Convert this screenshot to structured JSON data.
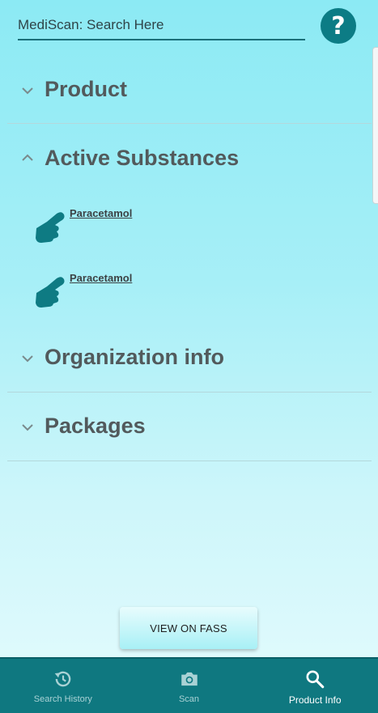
{
  "search": {
    "placeholder": "MediScan: Search Here"
  },
  "help": {
    "label": "?"
  },
  "sections": [
    {
      "title": "Product",
      "expanded": false
    },
    {
      "title": "Active Substances",
      "expanded": true,
      "items": [
        {
          "label": "Paracetamol"
        },
        {
          "label": "Paracetamol"
        }
      ]
    },
    {
      "title": "Organization info",
      "expanded": false
    },
    {
      "title": "Packages",
      "expanded": false
    }
  ],
  "action_button": {
    "label": "VIEW ON FASS"
  },
  "bottom_nav": {
    "items": [
      {
        "label": "Search History",
        "icon": "history-icon",
        "active": false
      },
      {
        "label": "Scan",
        "icon": "camera-icon",
        "active": false
      },
      {
        "label": "Product Info",
        "icon": "search-icon",
        "active": true
      }
    ]
  },
  "colors": {
    "accent": "#0c7c85",
    "nav_bg": "#0f7880",
    "title_text": "#525a5c"
  }
}
